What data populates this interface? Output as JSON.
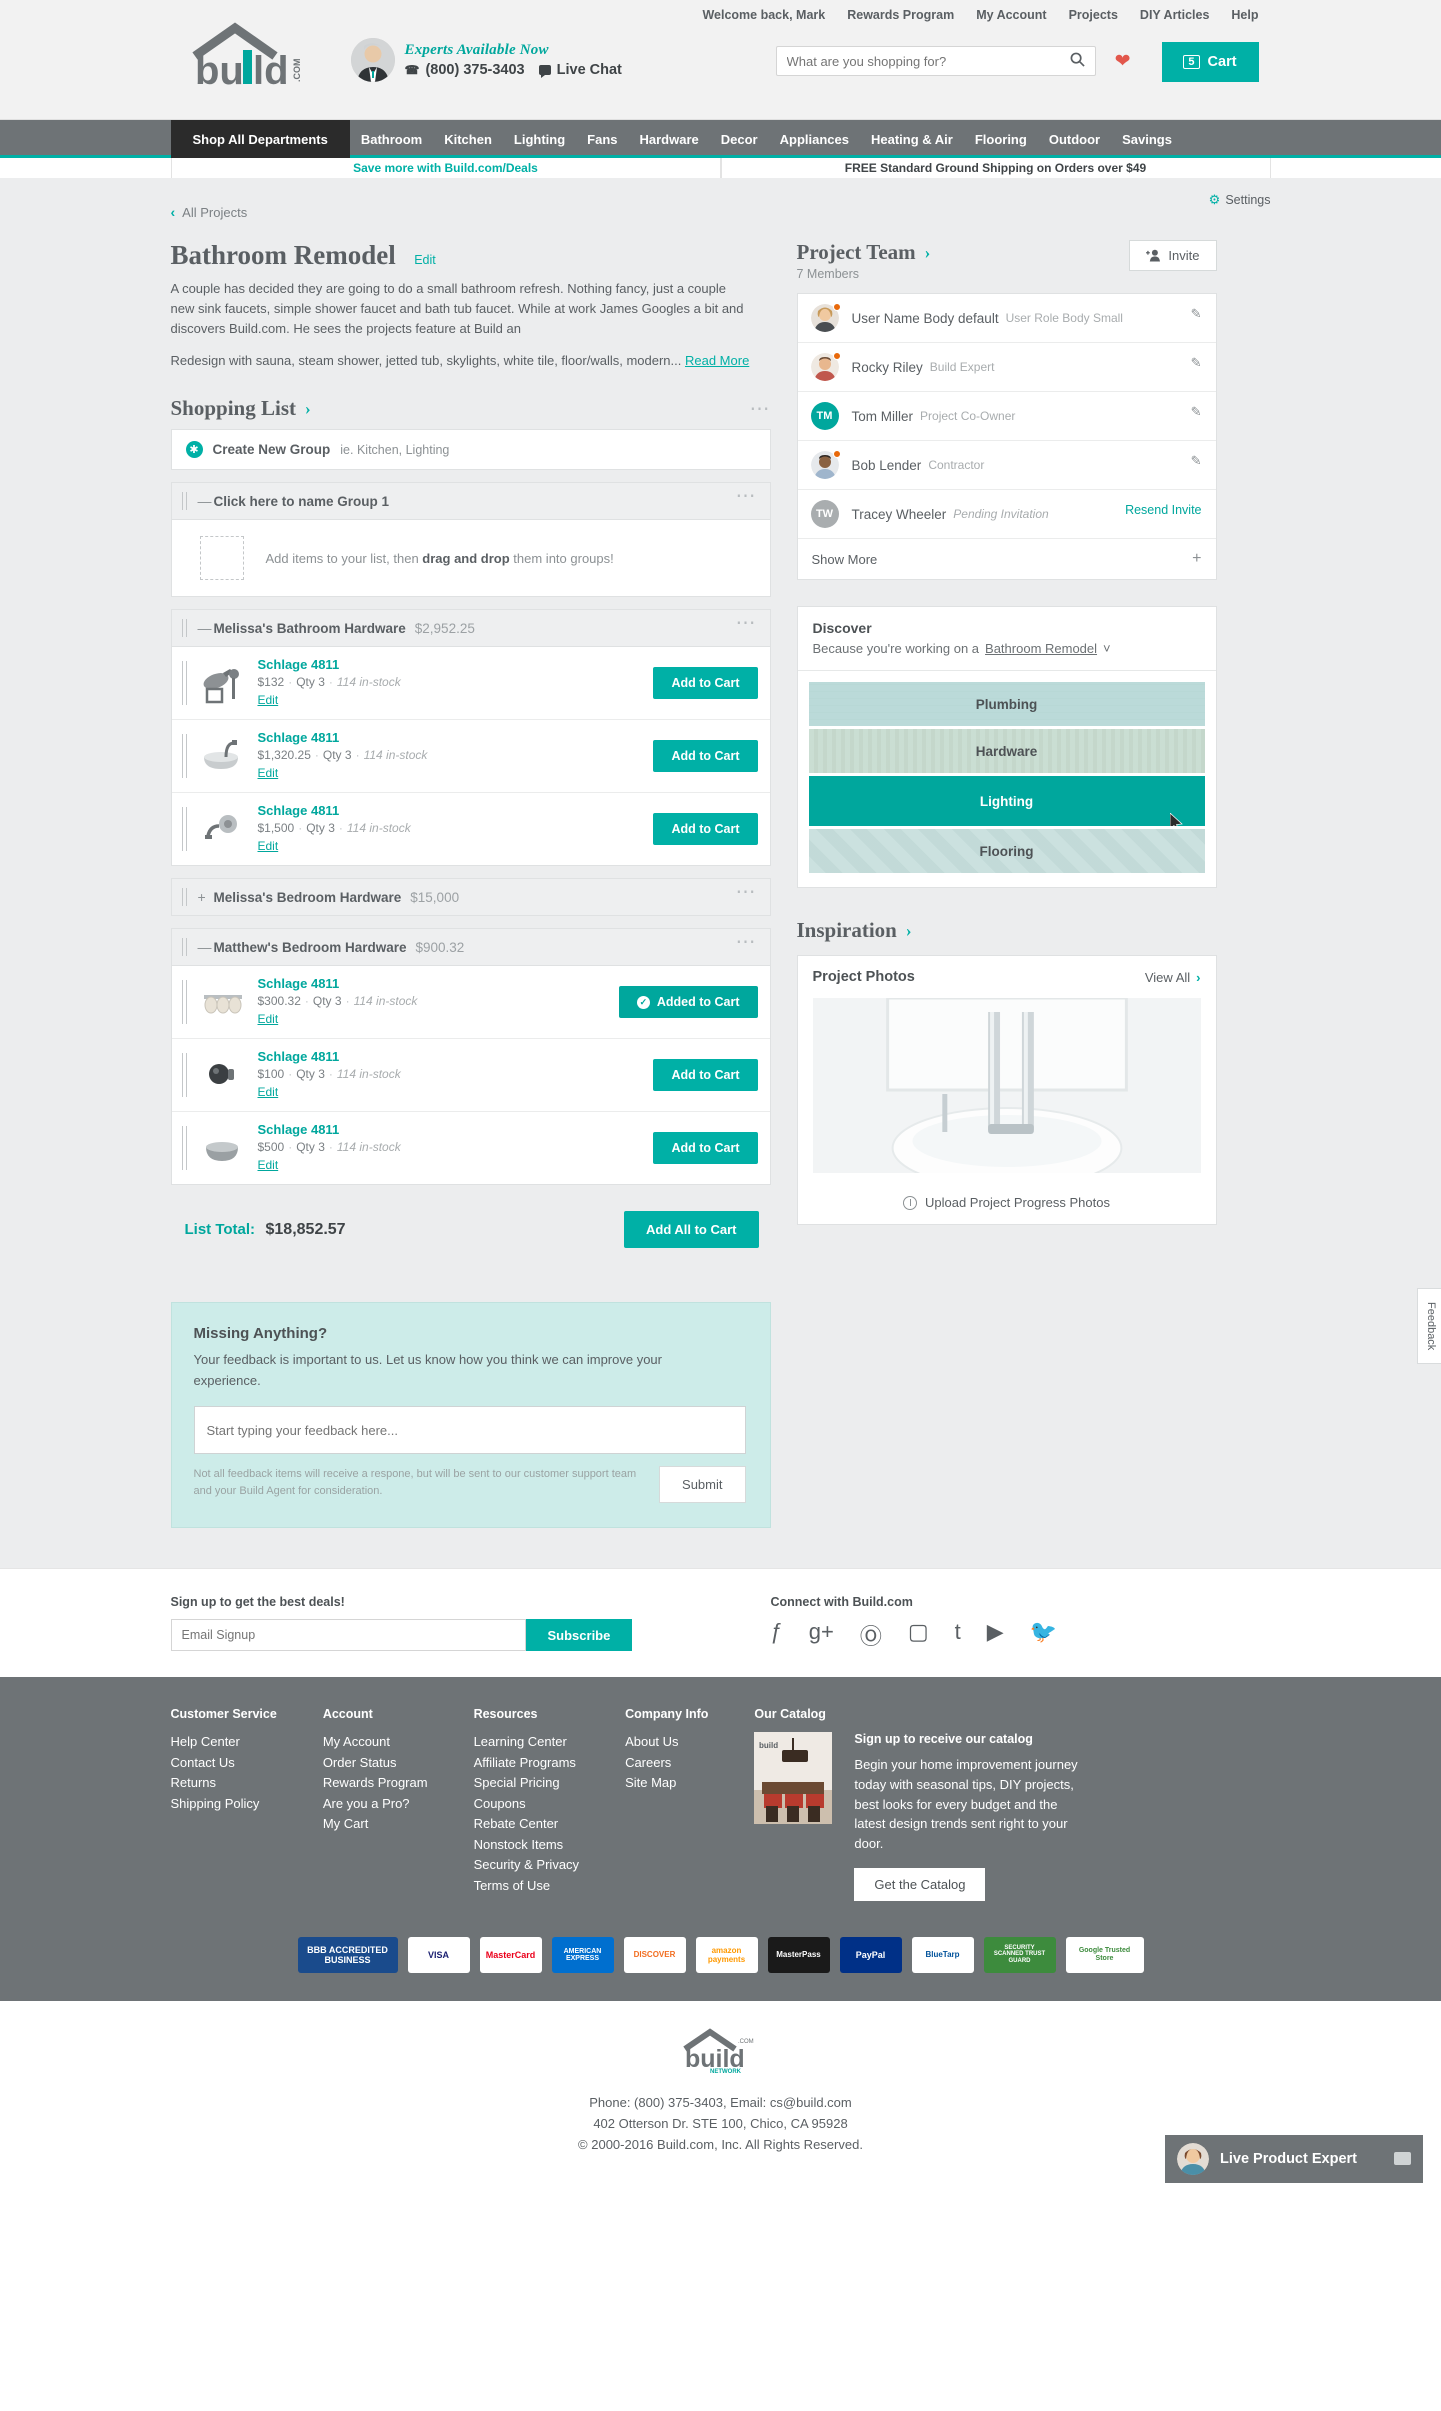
{
  "header": {
    "utility_links": [
      "Welcome back, Mark",
      "Rewards Program",
      "My Account",
      "Projects",
      "DIY Articles",
      "Help"
    ],
    "experts_tagline": "Experts Available Now",
    "phone": "(800) 375-3403",
    "live_chat": "Live Chat",
    "search_placeholder": "What are you shopping for?",
    "cart_label": "Cart",
    "cart_count": "5",
    "logo_text": "build",
    "logo_suffix": ".COM"
  },
  "nav": {
    "shop_all": "Shop All Departments",
    "items": [
      "Bathroom",
      "Kitchen",
      "Lighting",
      "Fans",
      "Hardware",
      "Decor",
      "Appliances",
      "Heating & Air",
      "Flooring",
      "Outdoor",
      "Savings"
    ]
  },
  "promo": {
    "left": "Save more with Build.com/Deals",
    "right": "FREE Standard Ground Shipping on Orders over $49"
  },
  "project": {
    "settings": "Settings",
    "back_link": "All Projects",
    "title": "Bathroom Remodel",
    "edit": "Edit",
    "description": "A couple has decided they are going to do a small bathroom refresh. Nothing fancy, just a couple new sink faucets, simple shower faucet and bath tub faucet. While at work James Googles a bit and discovers Build.com. He sees the projects feature at Build an",
    "description2": "Redesign with sauna, steam shower, jetted tub, skylights, white tile, floor/walls, modern...",
    "read_more": "Read More"
  },
  "shopping_list": {
    "heading": "Shopping List",
    "create_group_label": "Create New Group",
    "create_group_hint": "ie. Kitchen, Lighting",
    "empty_group": {
      "name": "Click here to name Group 1",
      "hint_prefix": "Add items to your list, then ",
      "hint_bold": "drag and drop",
      "hint_suffix": " them into groups!"
    },
    "groups": [
      {
        "name": "Melissa's Bathroom Hardware",
        "total": "$2,952.25",
        "collapsed": false,
        "items": [
          {
            "name": "Schlage 4811",
            "price": "$132",
            "qty": "Qty 3",
            "stock": "114 in-stock",
            "edit": "Edit",
            "cta": "Add to Cart",
            "added": false,
            "icon": "showerhead-icon"
          },
          {
            "name": "Schlage 4811",
            "price": "$1,320.25",
            "qty": "Qty 3",
            "stock": "114 in-stock",
            "edit": "Edit",
            "cta": "Add to Cart",
            "added": false,
            "icon": "sink-basin-icon"
          },
          {
            "name": "Schlage 4811",
            "price": "$1,500",
            "qty": "Qty 3",
            "stock": "114 in-stock",
            "edit": "Edit",
            "cta": "Add to Cart",
            "added": false,
            "icon": "faucet-icon"
          }
        ]
      },
      {
        "name": "Melissa's Bedroom Hardware",
        "total": "$15,000",
        "collapsed": true,
        "items": []
      },
      {
        "name": "Matthew's Bedroom Hardware",
        "total": "$900.32",
        "collapsed": false,
        "items": [
          {
            "name": "Schlage 4811",
            "price": "$300.32",
            "qty": "Qty 3",
            "stock": "114 in-stock",
            "edit": "Edit",
            "cta": "Added to Cart",
            "added": true,
            "icon": "vanity-light-icon"
          },
          {
            "name": "Schlage 4811",
            "price": "$100",
            "qty": "Qty 3",
            "stock": "114 in-stock",
            "edit": "Edit",
            "cta": "Add to Cart",
            "added": false,
            "icon": "knob-icon"
          },
          {
            "name": "Schlage 4811",
            "price": "$500",
            "qty": "Qty 3",
            "stock": "114 in-stock",
            "edit": "Edit",
            "cta": "Add to Cart",
            "added": false,
            "icon": "bowl-sink-icon"
          }
        ]
      }
    ],
    "list_total_label": "List Total:",
    "list_total_value": "$18,852.57",
    "add_all_label": "Add All to Cart"
  },
  "feedback": {
    "title": "Missing Anything?",
    "subtitle": "Your feedback is important to us. Let us know how you think we can improve your experience.",
    "placeholder": "Start typing your feedback here...",
    "note": "Not all feedback items will receive a respone, but will be sent to our customer support team and your Build Agent for consideration.",
    "submit": "Submit"
  },
  "team": {
    "heading": "Project Team",
    "member_count": "7 Members",
    "invite_label": "Invite",
    "members": [
      {
        "name": "User Name Body default",
        "role": "User Role Body Small",
        "initials": "",
        "avatar_color": "#d8b48a",
        "online": true,
        "action": "edit"
      },
      {
        "name": "Rocky Riley",
        "role": "Build Expert",
        "initials": "",
        "avatar_color": "#c86a5a",
        "online": true,
        "action": "edit"
      },
      {
        "name": "Tom Miller",
        "role": "Project Co-Owner",
        "initials": "TM",
        "avatar_color": "#00a79d",
        "online": false,
        "action": "edit"
      },
      {
        "name": "Bob Lender",
        "role": "Contractor",
        "initials": "",
        "avatar_color": "#8fa7c2",
        "online": true,
        "action": "edit"
      },
      {
        "name": "Tracey Wheeler",
        "role": "Pending Invitation",
        "initials": "TW",
        "avatar_color": "#a9adaf",
        "online": false,
        "action": "Resend Invite"
      }
    ],
    "show_more": "Show More"
  },
  "discover": {
    "title": "Discover",
    "subtitle_prefix": "Because you're working on a",
    "subtitle_project": "Bathroom Remodel",
    "tiles": [
      {
        "label": "Plumbing",
        "active": false
      },
      {
        "label": "Hardware",
        "active": false
      },
      {
        "label": "Lighting",
        "active": true
      },
      {
        "label": "Flooring",
        "active": false
      }
    ]
  },
  "inspiration": {
    "heading": "Inspiration",
    "photos_title": "Project Photos",
    "view_all": "View All",
    "upload_label": "Upload Project Progress Photos"
  },
  "signup": {
    "label": "Sign up to get the best deals!",
    "placeholder": "Email Signup",
    "button": "Subscribe",
    "connect_label": "Connect with Build.com",
    "social": [
      "facebook-icon",
      "google-plus-icon",
      "pinterest-icon",
      "instagram-icon",
      "tumblr-icon",
      "youtube-icon",
      "twitter-icon"
    ]
  },
  "footer": {
    "columns": [
      {
        "title": "Customer Service",
        "links": [
          "Help Center",
          "Contact Us",
          "Returns",
          "Shipping Policy"
        ]
      },
      {
        "title": "Account",
        "links": [
          "My Account",
          "Order Status",
          "Rewards Program",
          "Are you a Pro?",
          "My Cart"
        ]
      },
      {
        "title": "Resources",
        "links": [
          "Learning Center",
          "Affiliate Programs",
          "Special Pricing",
          "Coupons",
          "Rebate Center",
          "Nonstock Items",
          "Security & Privacy",
          "Terms of Use"
        ]
      },
      {
        "title": "Company Info",
        "links": [
          "About Us",
          "Careers",
          "Site Map"
        ]
      }
    ],
    "catalog": {
      "title": "Our Catalog",
      "signup_title": "Sign up to receive our catalog",
      "body": "Begin your home improvement journey today with seasonal tips, DIY projects, best looks for every budget and the latest design trends sent right to your door.",
      "button": "Get the Catalog"
    },
    "badges": [
      "BBB ACCREDITED BUSINESS",
      "VISA",
      "MasterCard",
      "AMERICAN EXPRESS",
      "DISCOVER",
      "amazon payments",
      "MasterPass",
      "PayPal",
      "BlueTarp",
      "SECURITY SCANNED TRUST GUARD",
      "Google Trusted Store"
    ],
    "bottom": {
      "logo": "build",
      "logo_sub": "NETWORK",
      "phone_line": "Phone: (800) 375-3403, Email: cs@build.com",
      "address_line": "402 Otterson Dr. STE 100, Chico, CA 95928",
      "copyright": "© 2000-2016 Build.com, Inc. All Rights Reserved."
    }
  },
  "floating": {
    "feedback_tab": "Feedback",
    "live_expert": "Live Product Expert"
  }
}
